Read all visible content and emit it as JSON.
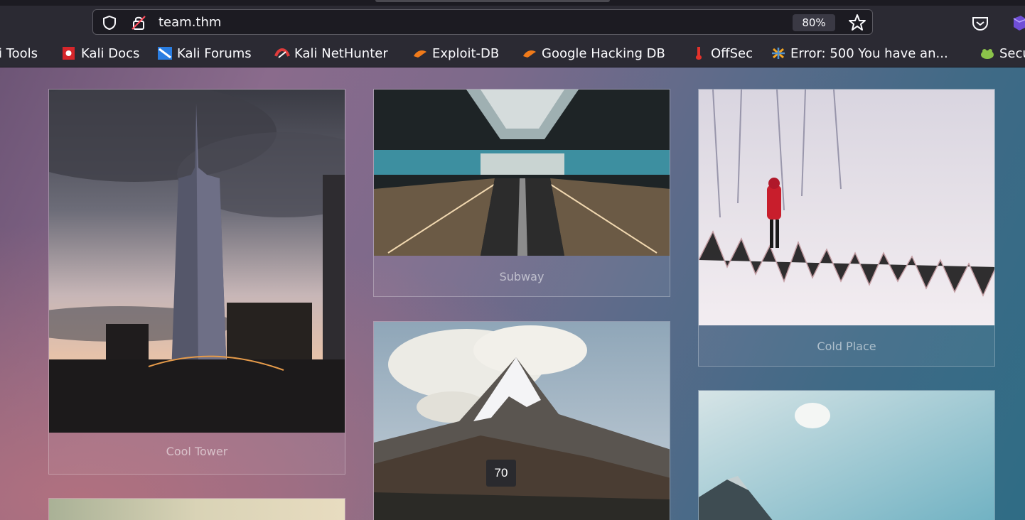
{
  "browser": {
    "url": "team.thm",
    "zoom": "80%"
  },
  "bookmarks": [
    {
      "label": "i Tools",
      "icon": "kali-tools-icon"
    },
    {
      "label": "Kali Docs",
      "icon": "kali-docs-icon"
    },
    {
      "label": "Kali Forums",
      "icon": "kali-forums-icon"
    },
    {
      "label": "Kali NetHunter",
      "icon": "kali-nethunter-icon"
    },
    {
      "label": "Exploit-DB",
      "icon": "exploit-db-icon"
    },
    {
      "label": "Google Hacking DB",
      "icon": "ghdb-icon"
    },
    {
      "label": "OffSec",
      "icon": "offsec-icon"
    },
    {
      "label": "Error: 500 You have an...",
      "icon": "joomla-icon"
    },
    {
      "label": "Secu",
      "icon": "security-icon"
    }
  ],
  "gallery": {
    "cards": [
      {
        "caption": "Cool Tower"
      },
      {
        "caption": "Subway"
      },
      {
        "caption": "Cold Place"
      },
      {
        "caption": ""
      },
      {
        "caption": ""
      },
      {
        "caption": ""
      }
    ],
    "overlay_badge": "70"
  }
}
